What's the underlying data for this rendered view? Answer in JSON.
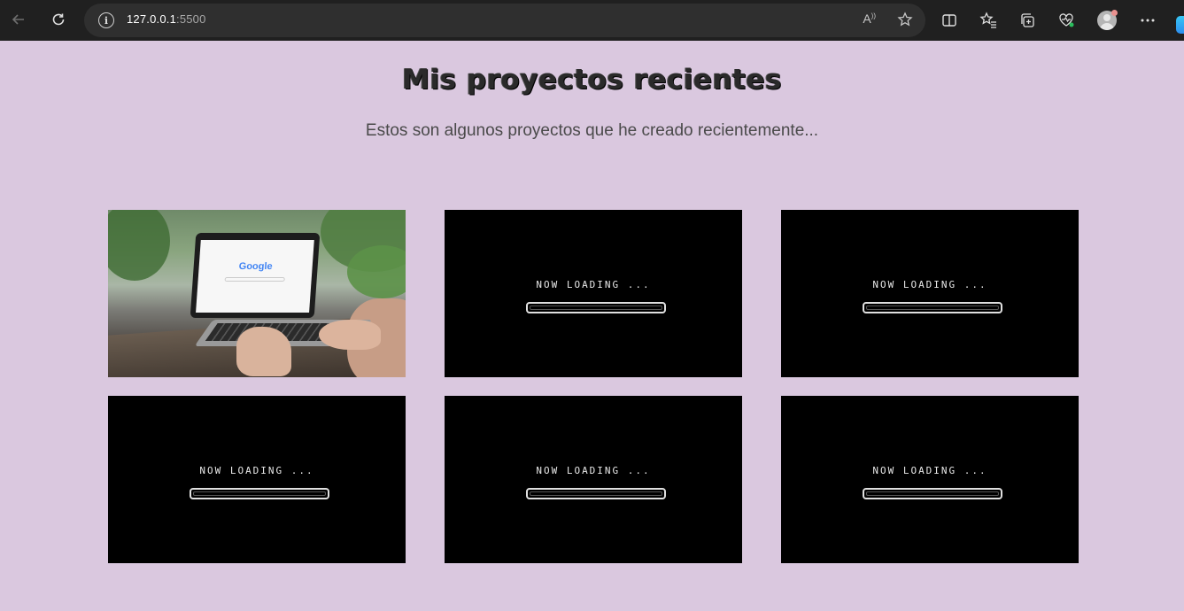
{
  "browser": {
    "url_host": "127.0.0.1",
    "url_port": ":5500",
    "read_aloud_label": "A"
  },
  "page": {
    "title": "Mis proyectos recientes",
    "subtitle": "Estos son algunos proyectos que he creado recientemente..."
  },
  "projects": [
    {
      "kind": "photo",
      "screen_logo": "Google"
    },
    {
      "kind": "loading",
      "label": "NOW LOADING ..."
    },
    {
      "kind": "loading",
      "label": "NOW LOADING ..."
    },
    {
      "kind": "loading",
      "label": "NOW LOADING ..."
    },
    {
      "kind": "loading",
      "label": "NOW LOADING ..."
    },
    {
      "kind": "loading",
      "label": "NOW LOADING ..."
    }
  ],
  "colors": {
    "page_background": "#dac8df",
    "browser_chrome": "#202020",
    "card_background": "#000000"
  }
}
